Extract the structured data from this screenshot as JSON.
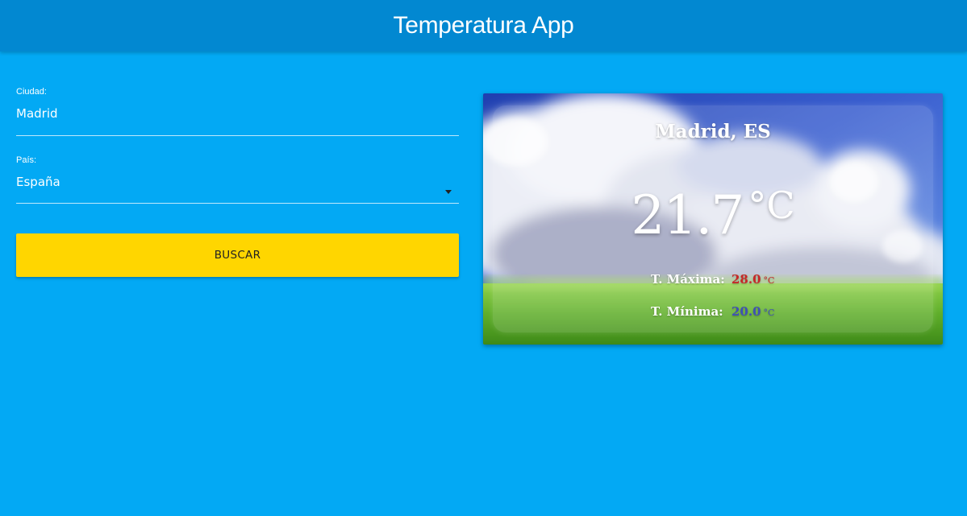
{
  "app": {
    "title": "Temperatura App"
  },
  "form": {
    "city": {
      "label": "Ciudad:",
      "value": "Madrid"
    },
    "country": {
      "label": "País:",
      "value": "España"
    },
    "search_label": "BUSCAR"
  },
  "weather": {
    "location": "Madrid, ES",
    "temperature": "21.7",
    "unit": "°C",
    "max_label": "T. Máxima:",
    "max_value": "28.0",
    "max_unit": "°C",
    "min_label": "T. Mínima:",
    "min_value": "20.0",
    "min_unit": "°C"
  },
  "colors": {
    "background": "#03a9f4",
    "appbar": "#0288d1",
    "button": "#ffd600",
    "max_temp": "#c62828",
    "min_temp": "#3f51b5"
  },
  "icons": {
    "country_select": "chevron-down-icon"
  }
}
